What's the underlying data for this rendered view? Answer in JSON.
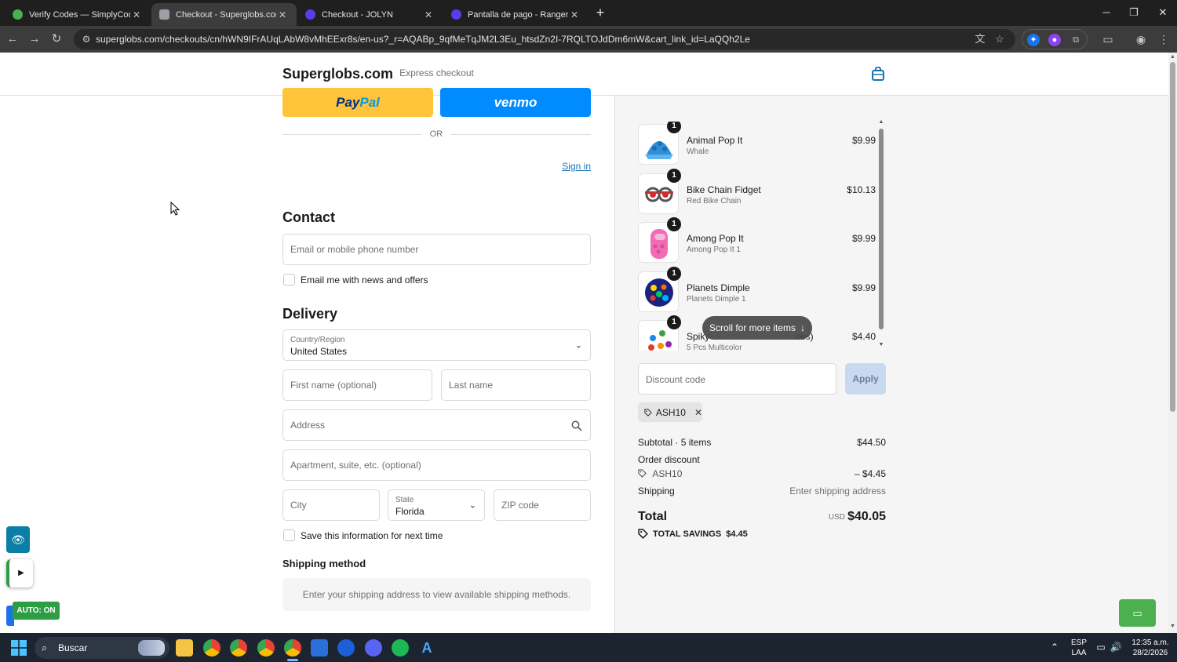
{
  "browser": {
    "tabs": [
      {
        "title": "Verify Codes — SimplyCodes",
        "active": false,
        "favicon_color": "#4caf50"
      },
      {
        "title": "Checkout - Superglobs.com",
        "active": true,
        "favicon_color": "#9aa0a6"
      },
      {
        "title": "Checkout - JOLYN",
        "active": false,
        "favicon_color": "#5a3cf0"
      },
      {
        "title": "Pantalla de pago - Ranger Ink",
        "active": false,
        "favicon_color": "#5a3cf0"
      }
    ],
    "new_tab_symbol": "+",
    "url": "superglobs.com/checkouts/cn/hWN9IFrAUqLAbW8vMhEExr8s/en-us?_r=AQABp_9qfMeTqJM2L3Eu_htsdZn2I-7RQLTOJdDm6mW&cart_link_id=LaQQh2Le"
  },
  "header": {
    "site_title": "Superglobs.com",
    "cart_icon": "shopping-bag-icon"
  },
  "express": {
    "label": "Express checkout",
    "paypal_part1": "Pay",
    "paypal_part2": "Pal",
    "venmo": "venmo",
    "or": "OR"
  },
  "contact": {
    "heading": "Contact",
    "sign_in": "Sign in",
    "email_placeholder": "Email or mobile phone number",
    "news_label": "Email me with news and offers"
  },
  "delivery": {
    "heading": "Delivery",
    "country_label": "Country/Region",
    "country_value": "United States",
    "first_name_placeholder": "First name (optional)",
    "last_name_placeholder": "Last name",
    "address_placeholder": "Address",
    "apartment_placeholder": "Apartment, suite, etc. (optional)",
    "city_placeholder": "City",
    "state_label": "State",
    "state_value": "Florida",
    "zip_placeholder": "ZIP code",
    "save_label": "Save this information for next time"
  },
  "shipping_method": {
    "heading": "Shipping method",
    "message": "Enter your shipping address to view available shipping methods."
  },
  "order": {
    "items": [
      {
        "name": "Animal Pop It",
        "variant": "Whale",
        "price": "$9.99",
        "qty": "1"
      },
      {
        "name": "Bike Chain Fidget",
        "variant": "Red Bike Chain",
        "price": "$10.13",
        "qty": "1"
      },
      {
        "name": "Among Pop It",
        "variant": "Among Pop It 1",
        "price": "$9.99",
        "qty": "1"
      },
      {
        "name": "Planets Dimple",
        "variant": "Planets Dimple 1",
        "price": "$9.99",
        "qty": "1"
      },
      {
        "name": "Spiky",
        "name_tail": "ces)",
        "variant": "5 Pcs Multicolor",
        "price": "$4.40",
        "qty": "1"
      }
    ],
    "scroll_hint": "Scroll for more items",
    "discount_placeholder": "Discount code",
    "apply_label": "Apply",
    "applied_code": "ASH10",
    "subtotal_label": "Subtotal · 5 items",
    "subtotal_value": "$44.50",
    "order_discount_label": "Order discount",
    "discount_code": "ASH10",
    "discount_value": "– $4.45",
    "shipping_label": "Shipping",
    "shipping_value": "Enter shipping address",
    "total_label": "Total",
    "currency": "USD",
    "total_value": "$40.05",
    "savings_label": "TOTAL SAVINGS",
    "savings_value": "$4.45"
  },
  "widgets": {
    "auto_label": "AUTO: ON"
  },
  "taskbar": {
    "search_label": "Buscar",
    "lang_top": "ESP",
    "lang_bottom": "LAA",
    "time": "12:35 a.m.",
    "date": "28/2/2026"
  }
}
